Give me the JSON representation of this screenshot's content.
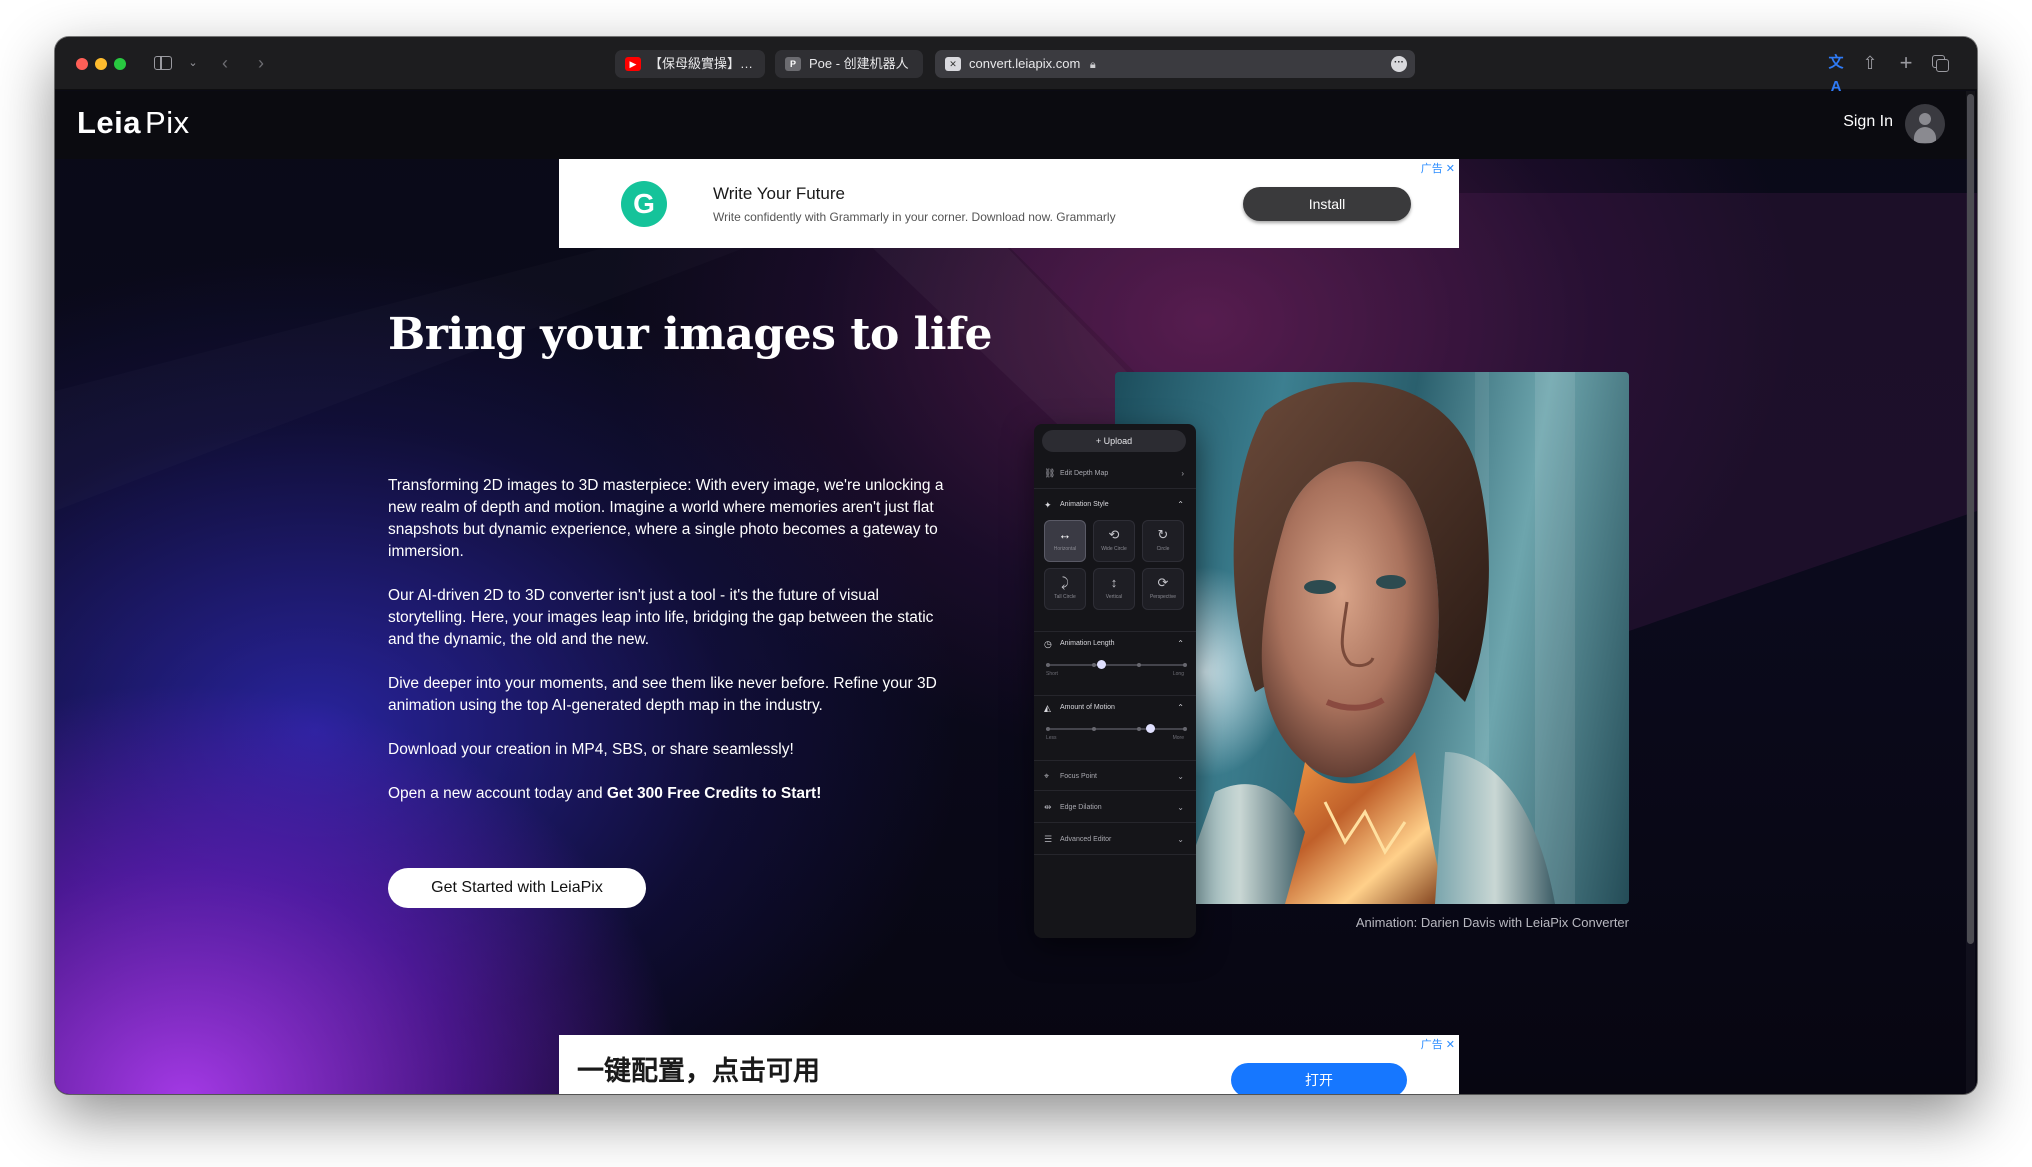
{
  "browser": {
    "tabs": [
      {
        "title": "【保母級實操】…",
        "favicon": "youtube-icon"
      },
      {
        "title": "Poe - 创建机器人",
        "favicon": "p"
      },
      {
        "title": "convert.leiapix.com",
        "favicon": "leiapix-icon"
      }
    ]
  },
  "site": {
    "logo_bold": "Leia",
    "logo_light": "Pix",
    "sign_in": "Sign In"
  },
  "ad_top": {
    "choices_label": "广告",
    "logo_letter": "G",
    "title": "Write Your Future",
    "text": "Write confidently with Grammarly in your corner. Download now. Grammarly",
    "button": "Install"
  },
  "hero": {
    "title": "Bring your images to life",
    "p1": "Transforming 2D images to 3D masterpiece: With every image, we're unlocking a new realm of depth and motion. Imagine a world where memories aren't just flat snapshots but dynamic experience, where a single photo becomes a gateway to immersion.",
    "p2": "Our AI-driven 2D to 3D converter isn't just a tool - it's the future of visual storytelling. Here, your images leap into life, bridging the gap between the static and the dynamic, the old and the new.",
    "p3": "Dive deeper into your moments, and see them like never before. Refine your 3D animation using the top AI-generated depth map in the industry.",
    "p4": "Download your creation in MP4, SBS, or share seamlessly!",
    "p5_prefix": "Open a new account today and ",
    "p5_bold": "Get 300 Free Credits to Start!",
    "cta": "Get Started with LeiaPix"
  },
  "editor": {
    "upload": "+ Upload",
    "edit_depth_map": "Edit Depth Map",
    "animation_style": "Animation Style",
    "styles": [
      {
        "label": "Horizontal",
        "icon": "↔"
      },
      {
        "label": "Wide Circle",
        "icon": "⟲"
      },
      {
        "label": "Circle",
        "icon": "↻"
      },
      {
        "label": "Tall Circle",
        "icon": "⤸"
      },
      {
        "label": "Vertical",
        "icon": "↕"
      },
      {
        "label": "Perspective",
        "icon": "⟳"
      }
    ],
    "animation_length": "Animation Length",
    "length_min": "Short",
    "length_max": "Long",
    "length_value": 0.4,
    "amount_of_motion": "Amount of Motion",
    "motion_min": "Less",
    "motion_max": "More",
    "motion_value": 0.75,
    "focus_point": "Focus Point",
    "edge_dilation": "Edge Dilation",
    "advanced_editor": "Advanced Editor"
  },
  "caption": "Animation: Darien Davis with LeiaPix Converter",
  "ad_bottom": {
    "choices_label": "广告",
    "title": "一键配置，点击可用",
    "button": "打开"
  },
  "colors": {
    "accent_purple": "#ac3cf0",
    "accent_blue": "#302abe",
    "grammarly_green": "#15c39a",
    "open_button_blue": "#1677ff"
  }
}
